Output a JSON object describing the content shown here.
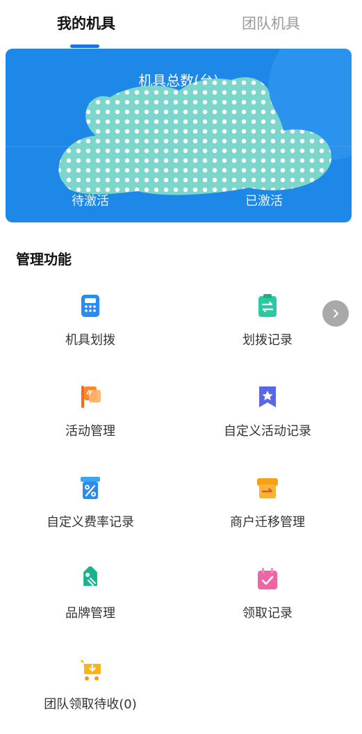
{
  "tabs": {
    "my_devices": "我的机具",
    "team_devices": "团队机具"
  },
  "summary_card": {
    "title": "机具总数(台)",
    "left_label": "待激活",
    "right_label": "已激活"
  },
  "section": {
    "title": "管理功能"
  },
  "functions": [
    {
      "label": "机具划拨",
      "icon": "calculator-icon"
    },
    {
      "label": "划拨记录",
      "icon": "transfer-record-icon"
    },
    {
      "label": "活动管理",
      "icon": "flag-icon"
    },
    {
      "label": "自定义活动记录",
      "icon": "star-bookmark-icon"
    },
    {
      "label": "自定义费率记录",
      "icon": "percent-icon"
    },
    {
      "label": "商户迁移管理",
      "icon": "store-transfer-icon"
    },
    {
      "label": "品牌管理",
      "icon": "tag-icon"
    },
    {
      "label": "领取记录",
      "icon": "calendar-check-icon"
    },
    {
      "label": "团队领取待收(0)",
      "icon": "cart-icon"
    }
  ],
  "colors": {
    "accent": "#1a73e8",
    "card_bg": "#1e88e8"
  }
}
